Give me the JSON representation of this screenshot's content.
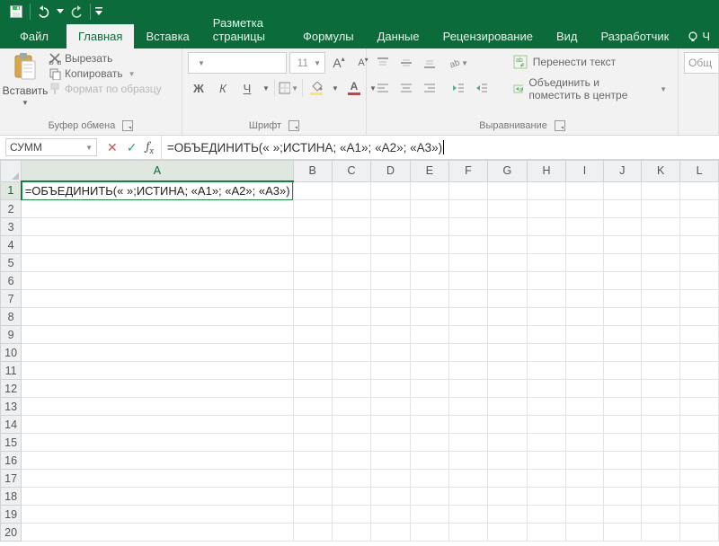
{
  "qat": {
    "save_tip": "Save",
    "undo_tip": "Undo",
    "redo_tip": "Redo",
    "customize_tip": "Customize"
  },
  "tabs": {
    "file": "Файл",
    "home": "Главная",
    "insert": "Вставка",
    "pagelayout": "Разметка страницы",
    "formulas": "Формулы",
    "data": "Данные",
    "review": "Рецензирование",
    "view": "Вид",
    "developer": "Разработчик",
    "tell": "Ч"
  },
  "clipboard": {
    "paste": "Вставить",
    "cut": "Вырезать",
    "copy": "Копировать",
    "format_painter": "Формат по образцу",
    "caption": "Буфер обмена"
  },
  "font": {
    "font_name_placeholder": "",
    "font_size": "11",
    "grow": "A",
    "shrink": "A",
    "bold": "Ж",
    "italic": "К",
    "underline": "Ч",
    "caption": "Шрифт",
    "fontcolor_hex": "#d93b3b",
    "fillcolor_hex": "#ffe36b"
  },
  "alignment": {
    "wrap": "Перенести текст",
    "merge": "Объединить и поместить в центре",
    "caption": "Выравнивание"
  },
  "number": {
    "format": "Общ",
    "caption": ""
  },
  "formula_bar": {
    "namebox": "СУММ",
    "formula": "=ОБЪЕДИНИТЬ(« »;ИСТИНА; «А1»; «А2»; «А3»)"
  },
  "grid": {
    "columns": [
      "A",
      "B",
      "C",
      "D",
      "E",
      "F",
      "G",
      "H",
      "I",
      "J",
      "K",
      "L"
    ],
    "rows": 20,
    "active_col": "A",
    "active_row": 1,
    "cell_A1": "=ОБЪЕДИНИТЬ(« »;ИСТИНА; «А1»; «А2»; «А3»)"
  }
}
